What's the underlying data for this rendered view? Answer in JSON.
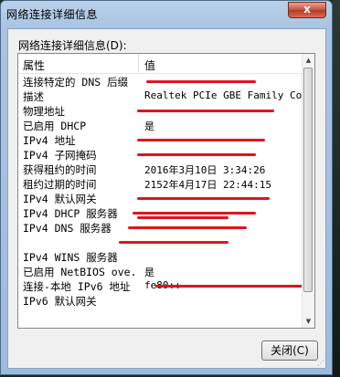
{
  "window": {
    "title": "网络连接详细信息",
    "close_glyph": "x"
  },
  "section_label": "网络连接详细信息(D):",
  "table": {
    "headers": {
      "property": "属性",
      "value": "值"
    },
    "rows": [
      {
        "property": "连接特定的 DNS 后缀",
        "value": "",
        "redacted": true
      },
      {
        "property": "描述",
        "value": "Realtek PCIe GBE Family Controller",
        "redacted": false
      },
      {
        "property": "物理地址",
        "value": "",
        "redacted": true
      },
      {
        "property": "已启用 DHCP",
        "value": "是",
        "redacted": false
      },
      {
        "property": "IPv4 地址",
        "value": "",
        "redacted": true
      },
      {
        "property": "IPv4 子网掩码",
        "value": "",
        "redacted": true
      },
      {
        "property": "获得租约的时间",
        "value": "2016年3月10日 3:34:26",
        "redacted": false
      },
      {
        "property": "租约过期的时间",
        "value": "2152年4月17日 22:44:15",
        "redacted": false
      },
      {
        "property": "IPv4 默认网关",
        "value": "",
        "redacted": true
      },
      {
        "property": "IPv4 DHCP 服务器",
        "value": "",
        "redacted": true
      },
      {
        "property": "IPv4 DNS 服务器",
        "value": "",
        "redacted": true
      },
      {
        "property": "",
        "value": "",
        "redacted": true
      },
      {
        "property": "IPv4 WINS 服务器",
        "value": "",
        "redacted": false
      },
      {
        "property": "已启用 NetBIOS ove...",
        "value": "是",
        "redacted": false
      },
      {
        "property": "连接-本地 IPv6 地址",
        "value": "fe80::",
        "redacted": true
      },
      {
        "property": "IPv6 默认网关",
        "value": "",
        "redacted": false
      }
    ]
  },
  "buttons": {
    "close_label": "关闭(C)"
  },
  "colors": {
    "redaction": "#e0141e",
    "title_bar": "#b9d1ea"
  }
}
